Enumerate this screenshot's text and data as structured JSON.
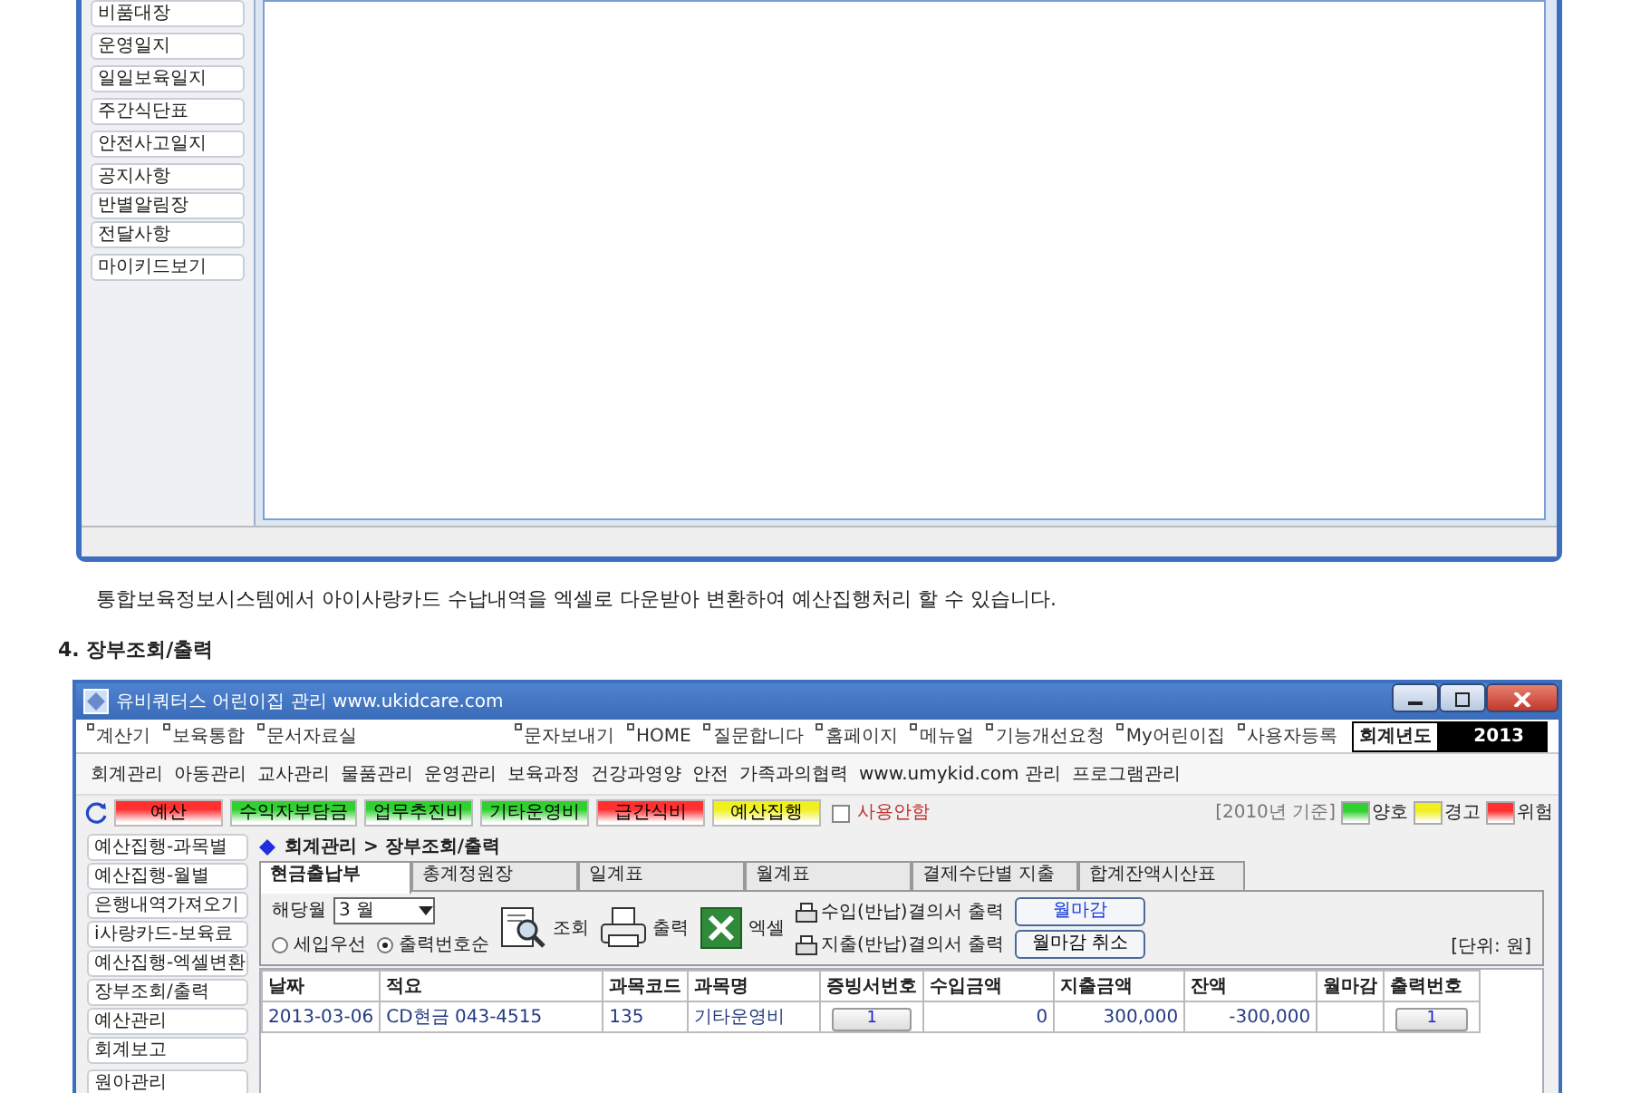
{
  "upper_window": {
    "sidebar_groups": [
      [
        "비품대장"
      ],
      [
        "운영일지"
      ],
      [
        "일일보육일지"
      ],
      [
        "주간식단표"
      ],
      [
        "안전사고일지"
      ],
      [
        "공지사항",
        "반별알림장",
        "전달사항"
      ],
      [
        "마이키드보기"
      ]
    ]
  },
  "caption": "통합보육정보시스템에서 아이사랑카드 수납내역을 엑셀로 다운받아 변환하여 예산집행처리 할 수 있습니다.",
  "section_heading": "4. 장부조회/출력",
  "app_window": {
    "title": "유비쿼터스 어린이집 관리 www.ukidcare.com",
    "quick_links_left": [
      "계산기",
      "보육통합",
      "문서자료실"
    ],
    "quick_links_right": [
      "문자보내기",
      "HOME",
      "질문합니다",
      "홈페이지",
      "메뉴얼",
      "기능개선요청",
      "My어린이집",
      "사용자등록"
    ],
    "fiscal_year": {
      "label": "회계년도",
      "value": "2013"
    },
    "menu": [
      "회계관리",
      "아동관리",
      "교사관리",
      "물품관리",
      "운영관리",
      "보육과정",
      "건강과영양",
      "안전",
      "가족과의협력",
      "www.umykid.com 관리",
      "프로그램관리"
    ],
    "budget_buttons": [
      {
        "label": "예산",
        "color": "#ff3030"
      },
      {
        "label": "수익자부담금",
        "color": "#30d030"
      },
      {
        "label": "업무추진비",
        "color": "#30d030"
      },
      {
        "label": "기타운영비",
        "color": "#30d030"
      },
      {
        "label": "급간식비",
        "color": "#ff3030"
      },
      {
        "label": "예산집행",
        "color": "#f0f020"
      }
    ],
    "unused_checkbox": {
      "label": "사용안함",
      "checked": false
    },
    "legend_note": "[2010년 기준]",
    "legend": [
      {
        "label": "양호",
        "color": "#30d030"
      },
      {
        "label": "경고",
        "color": "#f0f020"
      },
      {
        "label": "위험",
        "color": "#ff3030"
      }
    ],
    "sidebar_groups": [
      [
        "예산집행-과목별",
        "예산집행-월별",
        "은행내역가져오기",
        "i사랑카드-보육료",
        "예산집행-엑셀변환",
        "장부조회/출력",
        "예산관리",
        "회계보고"
      ],
      [
        "원아관리"
      ]
    ],
    "breadcrumb": "회계관리 > 장부조회/출력",
    "tabs": [
      {
        "label": "현금출납부",
        "selected": true
      },
      {
        "label": "총계정원장",
        "selected": false
      },
      {
        "label": "일계표",
        "selected": false
      },
      {
        "label": "월계표",
        "selected": false
      },
      {
        "label": "결제수단별 지출",
        "selected": false
      },
      {
        "label": "합계잔액시산표",
        "selected": false
      }
    ],
    "month": {
      "label": "해당월",
      "value": "3 월"
    },
    "sort_options": [
      {
        "label": "세입우선",
        "selected": false
      },
      {
        "label": "출력번호순",
        "selected": true
      }
    ],
    "actions": [
      {
        "label": "조회",
        "kind": "search"
      },
      {
        "label": "출력",
        "kind": "print"
      },
      {
        "label": "엑셀",
        "kind": "excel"
      }
    ],
    "print_links": [
      "수입(반납)결의서 출력",
      "지출(반납)결의서 출력"
    ],
    "close_buttons": [
      {
        "label": "월마감",
        "kind": "primary"
      },
      {
        "label": "월마감 취소",
        "kind": "normal"
      }
    ],
    "unit": "[단위: 원]",
    "table": {
      "columns": [
        {
          "label": "날짜",
          "kind": "date"
        },
        {
          "label": "적요",
          "kind": "text"
        },
        {
          "label": "과목코드",
          "kind": "text"
        },
        {
          "label": "과목명",
          "kind": "text"
        },
        {
          "label": "증빙서번호",
          "kind": "button"
        },
        {
          "label": "수입금액",
          "kind": "number"
        },
        {
          "label": "지출금액",
          "kind": "number"
        },
        {
          "label": "잔액",
          "kind": "number"
        },
        {
          "label": "월마감",
          "kind": "text"
        },
        {
          "label": "출력번호",
          "kind": "button"
        }
      ],
      "rows": [
        [
          "2013-03-06",
          "CD현금 043-4515",
          "135",
          "기타운영비",
          "1",
          "0",
          "300,000",
          "-300,000",
          null,
          "1"
        ]
      ]
    }
  }
}
